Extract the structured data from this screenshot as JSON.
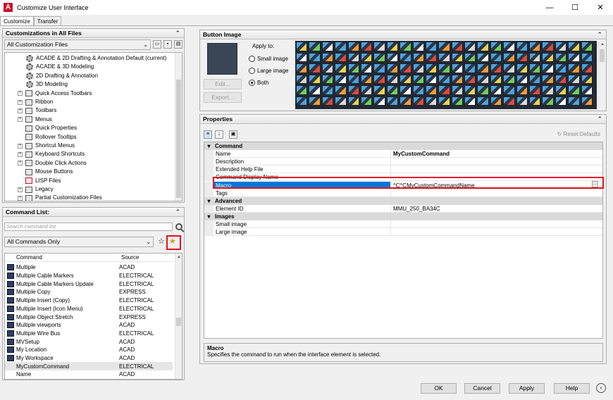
{
  "window": {
    "title": "Customize User Interface",
    "controls": [
      "—",
      "☐",
      "✕"
    ]
  },
  "tabs": [
    "Customize",
    "Transfer"
  ],
  "customizations": {
    "header": "Customizations in All Files",
    "filter": "All Customization Files",
    "tree": [
      {
        "label": "ACADE & 2D Drafting & Annotation Default (current)",
        "icon": "gear-icon",
        "indent": 2,
        "expander": false
      },
      {
        "label": "ACADE & 3D Modeling",
        "icon": "gear-icon",
        "indent": 2,
        "expander": false
      },
      {
        "label": "2D Drafting & Annotation",
        "icon": "gear-icon",
        "indent": 2,
        "expander": false
      },
      {
        "label": "3D Modeling",
        "icon": "gear-icon",
        "indent": 2,
        "expander": false
      },
      {
        "label": "Quick Access Toolbars",
        "icon": "toolbar-icon",
        "indent": 1,
        "expander": true
      },
      {
        "label": "Ribbon",
        "icon": "ribbon-icon",
        "indent": 1,
        "expander": true
      },
      {
        "label": "Toolbars",
        "icon": "toolbar-icon",
        "indent": 1,
        "expander": true
      },
      {
        "label": "Menus",
        "icon": "menu-icon",
        "indent": 1,
        "expander": true
      },
      {
        "label": "Quick Properties",
        "icon": "properties-icon",
        "indent": 1,
        "expander": false
      },
      {
        "label": "Rollover Tooltips",
        "icon": "tooltip-icon",
        "indent": 1,
        "expander": false
      },
      {
        "label": "Shortcut Menus",
        "icon": "menu-icon",
        "indent": 1,
        "expander": true
      },
      {
        "label": "Keyboard Shortcuts",
        "icon": "keyboard-icon",
        "indent": 1,
        "expander": true
      },
      {
        "label": "Double Click Actions",
        "icon": "mouse-icon",
        "indent": 1,
        "expander": true
      },
      {
        "label": "Mouse Buttons",
        "icon": "mouse-icon",
        "indent": 1,
        "expander": false
      },
      {
        "label": "LISP Files",
        "icon": "lisp-icon",
        "indent": 1,
        "expander": false
      },
      {
        "label": "Legacy",
        "icon": "legacy-icon",
        "indent": 1,
        "expander": true
      },
      {
        "label": "Partial Customization Files",
        "icon": "files-icon",
        "indent": 1,
        "expander": true
      }
    ]
  },
  "command_list": {
    "header": "Command List:",
    "search_placeholder": "Search command list",
    "filter": "All Commands Only",
    "columns": [
      "Command",
      "Source"
    ],
    "rows": [
      {
        "name": "Multiple",
        "source": "ACAD"
      },
      {
        "name": "Multiple Cable Markers",
        "source": "ELECTRICAL"
      },
      {
        "name": "Multiple Cable Markers Update",
        "source": "ELECTRICAL"
      },
      {
        "name": "Multiple Copy",
        "source": "EXPRESS"
      },
      {
        "name": "Multiple Insert (Copy)",
        "source": "ELECTRICAL"
      },
      {
        "name": "Multiple Insert (Icon Menu)",
        "source": "ELECTRICAL"
      },
      {
        "name": "Multiple Object Stretch",
        "source": "EXPRESS"
      },
      {
        "name": "Multiple viewports",
        "source": "ACAD"
      },
      {
        "name": "Multiple Wire Bus",
        "source": "ELECTRICAL"
      },
      {
        "name": "MVSetup",
        "source": "ACAD"
      },
      {
        "name": "My Location",
        "source": "ACAD"
      },
      {
        "name": "My Workspace",
        "source": "ACAD"
      },
      {
        "name": "MyCustomCommand",
        "source": "ELECTRICAL"
      },
      {
        "name": "Name",
        "source": "ACAD"
      }
    ],
    "selected_row": "MyCustomCommand"
  },
  "button_image": {
    "header": "Button Image",
    "apply_to_label": "Apply to:",
    "options": [
      "Small image",
      "Large image",
      "Both"
    ],
    "selected_option": "Both",
    "edit_label": "Edit...",
    "export_label": "Export..."
  },
  "properties": {
    "header": "Properties",
    "reset_label": "Reset Defaults",
    "rows": [
      {
        "type": "category",
        "name": "Command"
      },
      {
        "type": "prop",
        "name": "Name",
        "value": "MyCustomCommand",
        "bold": true
      },
      {
        "type": "prop",
        "name": "Description",
        "value": ""
      },
      {
        "type": "prop",
        "name": "Extended Help File",
        "value": ""
      },
      {
        "type": "prop",
        "name": "Command Display Name",
        "value": ""
      },
      {
        "type": "prop",
        "name": "Macro",
        "value": "^C^CMyCustomCommandName",
        "selected": true
      },
      {
        "type": "prop",
        "name": "Tags",
        "value": ""
      },
      {
        "type": "category",
        "name": "Advanced"
      },
      {
        "type": "prop",
        "name": "Element ID",
        "value": "MMU_250_BA34C"
      },
      {
        "type": "category",
        "name": "Images"
      },
      {
        "type": "prop",
        "name": "Small image",
        "value": ""
      },
      {
        "type": "prop",
        "name": "Large image",
        "value": ""
      }
    ],
    "description_title": "Macro",
    "description_text": "Specifies the command to run when the interface element is selected."
  },
  "footer": {
    "ok": "OK",
    "cancel": "Cancel",
    "apply": "Apply",
    "help": "Help"
  },
  "colors": {
    "highlight": "#0078d7",
    "annotation_red": "#e0141e",
    "icon_bg": "#232a36"
  }
}
